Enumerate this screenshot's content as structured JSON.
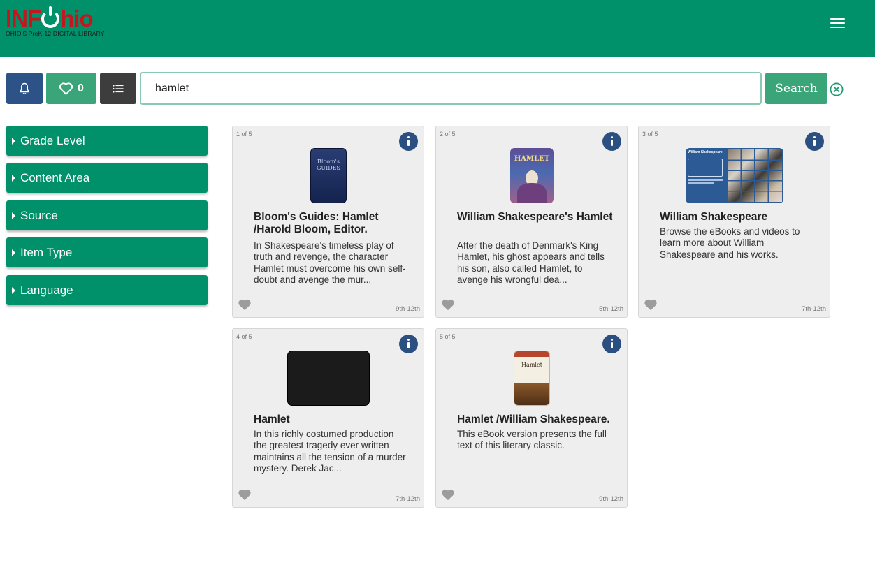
{
  "header": {
    "logo_pre": "INF",
    "logo_post": "hio",
    "logo_tagline": "OHIO'S PreK-12 DIGITAL LIBRARY",
    "color": "#00906a"
  },
  "toolbar": {
    "favorites_count": "0",
    "search_value": "hamlet",
    "search_label": "Search"
  },
  "facets": [
    {
      "label": "Grade Level"
    },
    {
      "label": "Content Area"
    },
    {
      "label": "Source"
    },
    {
      "label": "Item Type"
    },
    {
      "label": "Language"
    }
  ],
  "results": [
    {
      "index": "1 of 5",
      "title": "Bloom's Guides: Hamlet /Harold Bloom, Editor.",
      "description": "In Shakespeare's timeless play of truth and revenge, the character Hamlet must overcome his own self-doubt and avenge the mur...",
      "grade": "9th-12th",
      "thumb_text": "Bloom's GUIDES"
    },
    {
      "index": "2 of 5",
      "title": "William Shakespeare's Hamlet",
      "description": "After the death of Denmark's King Hamlet, his ghost appears and tells his son, also called Hamlet, to avenge his wrongful dea...",
      "grade": "5th-12th",
      "thumb_text": "HAMLET"
    },
    {
      "index": "3 of 5",
      "title": "William Shakespeare",
      "description": "Browse the eBooks and videos to learn more about William Shakespeare and his works.",
      "grade": "7th-12th",
      "thumb_text": "William Shakespeare"
    },
    {
      "index": "4 of 5",
      "title": "Hamlet",
      "description": "In this richly costumed production the greatest tragedy ever written maintains all the tension of a murder mystery. Derek Jac...",
      "grade": "7th-12th",
      "thumb_text": ""
    },
    {
      "index": "5 of 5",
      "title": "Hamlet /William Shakespeare.",
      "description": "This eBook version presents the full text of this literary classic.",
      "grade": "9th-12th",
      "thumb_text": "Hamlet"
    }
  ]
}
